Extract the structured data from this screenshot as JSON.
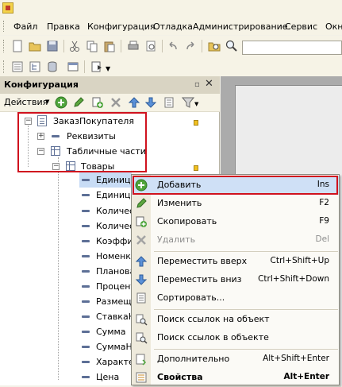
{
  "menu": {
    "items": [
      "Файл",
      "Правка",
      "Конфигурация",
      "Отладка",
      "Администрирование",
      "Сервис",
      "Окн"
    ]
  },
  "panel": {
    "title": "Конфигурация",
    "actions_label": "Действия"
  },
  "tree": {
    "root": "ЗаказПокупателя",
    "requisites": "Реквизиты",
    "tabular_parts": "Табличные части",
    "goods": "Товары",
    "attributes": [
      "Единица",
      "Единица",
      "Количес",
      "Количес",
      "Коэффи",
      "Номенк.",
      "Планова",
      "Процент",
      "Размещ",
      "СтавкаН",
      "Сумма",
      "СуммаН",
      "Характе",
      "Цена"
    ]
  },
  "context_menu": {
    "items": [
      {
        "label": "Добавить",
        "shortcut": "Ins",
        "icon": "add-icon"
      },
      {
        "label": "Изменить",
        "shortcut": "F2",
        "icon": "pencil-icon"
      },
      {
        "label": "Скопировать",
        "shortcut": "F9",
        "icon": "copy-icon"
      },
      {
        "label": "Удалить",
        "shortcut": "Del",
        "icon": "delete-icon"
      },
      {
        "label": "Переместить вверх",
        "shortcut": "Ctrl+Shift+Up",
        "icon": "arrow-up-icon"
      },
      {
        "label": "Переместить вниз",
        "shortcut": "Ctrl+Shift+Down",
        "icon": "arrow-down-icon"
      },
      {
        "label": "Сортировать...",
        "shortcut": "",
        "icon": "sort-icon"
      },
      {
        "label": "Поиск ссылок на объект",
        "shortcut": "",
        "icon": "find-refs-icon"
      },
      {
        "label": "Поиск ссылок в объекте",
        "shortcut": "",
        "icon": "find-in-object-icon"
      },
      {
        "label": "Дополнительно",
        "shortcut": "Alt+Shift+Enter",
        "icon": "more-icon"
      },
      {
        "label": "Свойства",
        "shortcut": "Alt+Enter",
        "icon": "properties-icon"
      }
    ]
  },
  "colors": {
    "highlight_border": "#d0121e",
    "selection": "#c8dcf5",
    "workspace": "#ababab"
  }
}
